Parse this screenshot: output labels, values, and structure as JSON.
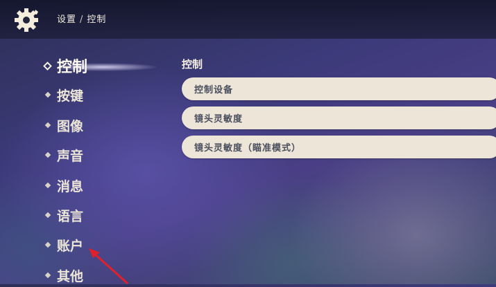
{
  "breadcrumb": {
    "root": "设置",
    "separator": "/",
    "current": "控制"
  },
  "nav": {
    "items": [
      {
        "label": "控制",
        "active": true
      },
      {
        "label": "按键"
      },
      {
        "label": "图像"
      },
      {
        "label": "声音"
      },
      {
        "label": "消息"
      },
      {
        "label": "语言"
      },
      {
        "label": "账户"
      },
      {
        "label": "其他"
      }
    ]
  },
  "main": {
    "title": "控制",
    "rows": [
      {
        "label": "控制设备"
      },
      {
        "label": "镜头灵敏度"
      },
      {
        "label": "镜头灵敏度（瞄准模式）"
      }
    ]
  },
  "colors": {
    "accent": "#ece5d8",
    "arrow": "#e0202a"
  }
}
